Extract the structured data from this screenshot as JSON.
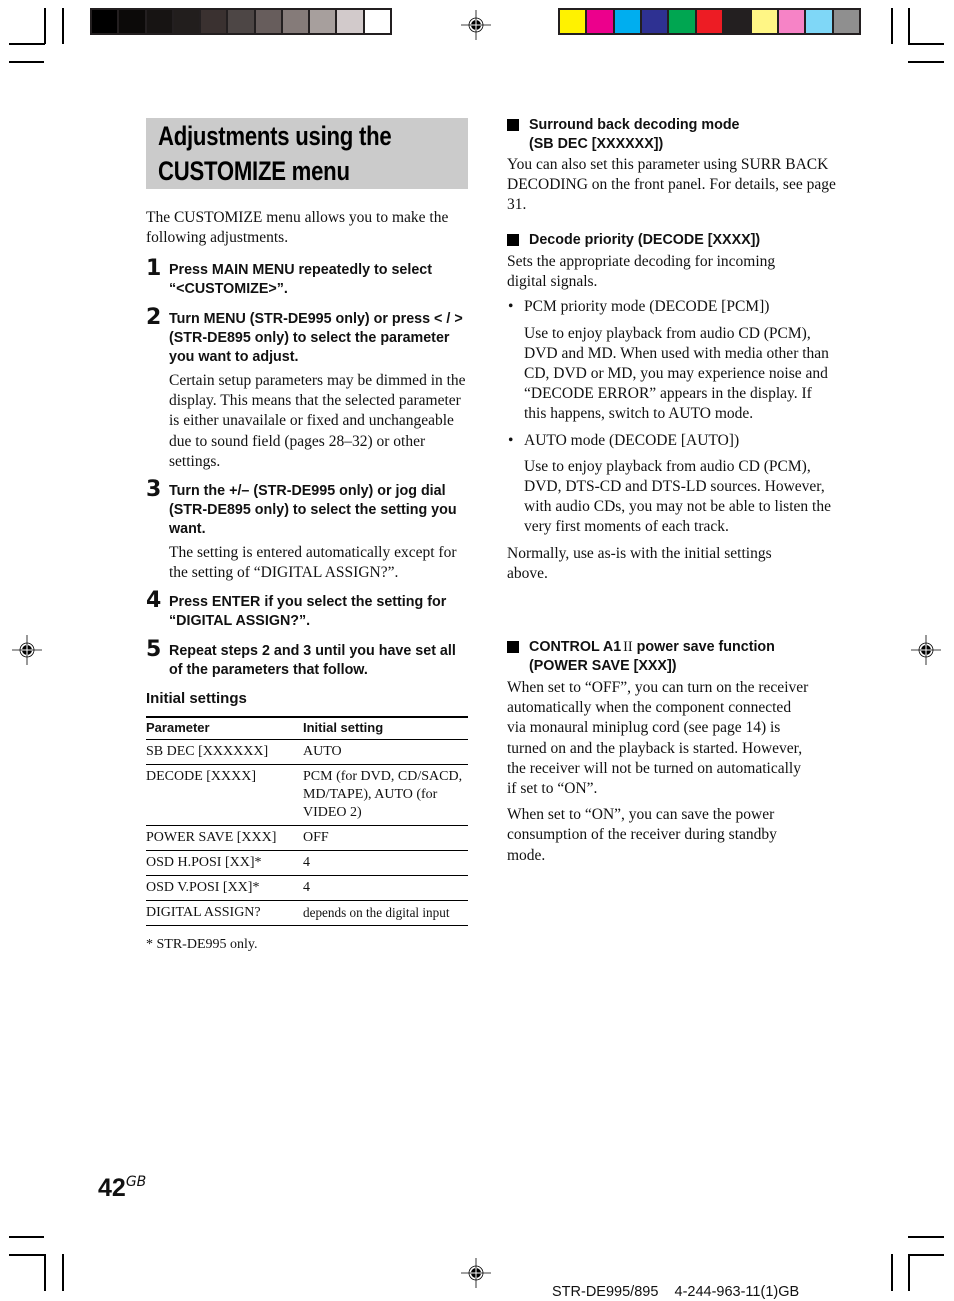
{
  "print_marks": {
    "gray_swatches": [
      "#000000",
      "#0c0a09",
      "#171413",
      "#221e1d",
      "#3a3130",
      "#4d4645",
      "#675d5c",
      "#857b79",
      "#a79f9d",
      "#d2cacb",
      "#ffffff"
    ],
    "color_swatches": [
      "#fff200",
      "#ec008c",
      "#00aeef",
      "#2e3192",
      "#00a651",
      "#ed1c24",
      "#231f20",
      "#fff685",
      "#f683c6",
      "#7fd7f7",
      "#8f8f8f"
    ]
  },
  "title": {
    "line1": "Adjustments using the",
    "line2": "CUSTOMIZE menu"
  },
  "intro": "The CUSTOMIZE menu allows you to make the following adjustments.",
  "steps": [
    {
      "number": "1",
      "heading": "Press MAIN MENU repeatedly to select “<CUSTOMIZE>”.",
      "description": ""
    },
    {
      "number": "2",
      "heading": "Turn MENU (STR-DE995 only) or press < / > (STR-DE895 only) to select the parameter you want to adjust.",
      "description": "Certain setup parameters may be dimmed in the display. This means that the selected parameter is either unavailale or fixed and unchangeable due to sound field (pages 28–32) or other settings."
    },
    {
      "number": "3",
      "heading": "Turn the +/– (STR-DE995 only) or jog dial (STR-DE895 only) to select the setting you want.",
      "description": "The setting is entered automatically except for the setting of “DIGITAL ASSIGN?”."
    },
    {
      "number": "4",
      "heading": "Press ENTER if you select the setting for “DIGITAL ASSIGN?”.",
      "description": ""
    },
    {
      "number": "5",
      "heading": "Repeat steps 2 and 3 until you have set all of the parameters that follow.",
      "description": ""
    }
  ],
  "initial_settings": {
    "heading": "Initial settings",
    "columns": [
      "Parameter",
      "Initial setting"
    ],
    "rows": [
      [
        "SB DEC [XXXXXX]",
        "AUTO"
      ],
      [
        "DECODE [XXXX]",
        "PCM (for  DVD, CD/SACD, MD/TAPE), AUTO (for VIDEO 2)"
      ],
      [
        "POWER SAVE [XXX]",
        "OFF"
      ],
      [
        "OSD H.POSI [XX]*",
        "4"
      ],
      [
        "OSD V.POSI [XX]*",
        "4"
      ],
      [
        "DIGITAL ASSIGN?",
        "depends on the digital input"
      ]
    ],
    "footnote": "* STR-DE995 only."
  },
  "sections": {
    "sb_dec": {
      "heading_line1": "Surround back decoding mode",
      "heading_line2": "(SB DEC [XXXXXX])",
      "body": "You can also set this parameter using SURR BACK DECODING on the front panel. For details, see page 31."
    },
    "decode": {
      "heading": "Decode priority (DECODE [XXXX])",
      "body": "Sets the appropriate decoding for incoming digital signals.",
      "bullets": [
        {
          "label": "PCM priority mode (DECODE [PCM])",
          "text": "Use to enjoy playback from audio CD (PCM), DVD and MD. When used with media other than CD, DVD or MD, you may experience noise and “DECODE ERROR” appears in the display. If this happens, switch to AUTO mode."
        },
        {
          "label": "AUTO mode (DECODE [AUTO])",
          "text": "Use to enjoy playback from audio CD (PCM), DVD, DTS-CD and DTS-LD sources. However, with audio CDs, you may not be able to listen the very first moments of each track."
        }
      ],
      "closing": "Normally, use as-is with the initial settings above."
    },
    "power_save": {
      "heading_line1_a": "CONTROL A1",
      "heading_line1_b": "II",
      "heading_line1_c": " power save function",
      "heading_line2": "(POWER SAVE [XXX])",
      "body1": "When set to “OFF”, you can turn on the receiver automatically when the component connected via monaural miniplug cord (see page 14) is turned on and the playback is started. However, the receiver will not be turned on automatically if set to “ON”.",
      "body2": "When set to “ON”, you can save the power consumption of the receiver during standby mode."
    }
  },
  "footer": {
    "page_number": "42",
    "page_suffix": "GB",
    "doc_id": "STR-DE995/895    4-244-963-11(1)GB"
  }
}
